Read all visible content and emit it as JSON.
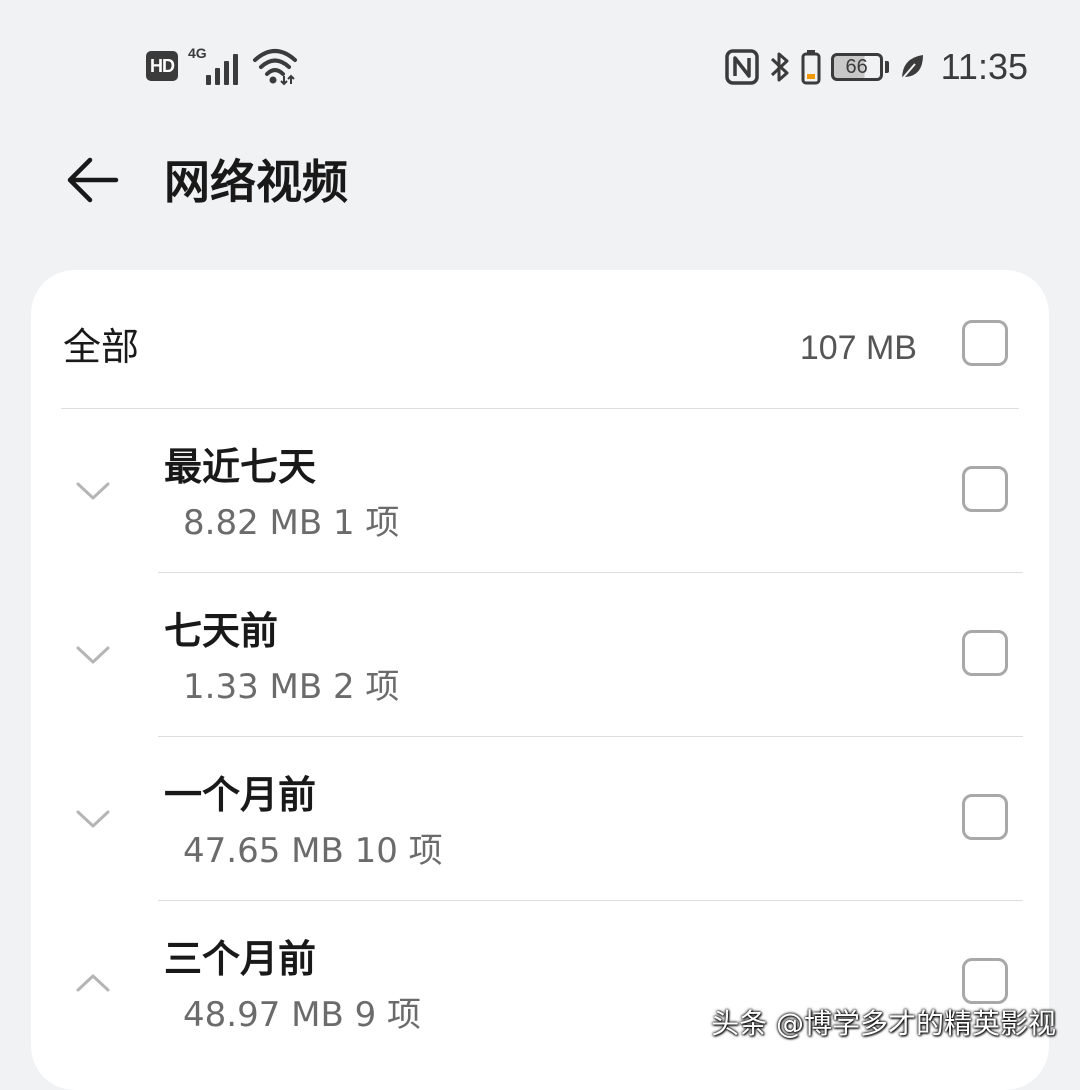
{
  "status_bar": {
    "hd_badge": "HD",
    "network_type": "4G",
    "battery_level": "66",
    "time": "11:35",
    "icons": [
      "hd-icon",
      "signal-icon",
      "wifi-icon",
      "nfc-icon",
      "bluetooth-icon",
      "battery-icon",
      "eco-leaf-icon"
    ]
  },
  "header": {
    "back_icon": "arrow-left-icon",
    "title": "网络视频"
  },
  "summary": {
    "label": "全部",
    "size": "107 MB",
    "checked": false
  },
  "groups": [
    {
      "title": "最近七天",
      "meta": "8.82 MB 1 项",
      "expanded": false,
      "checked": false
    },
    {
      "title": "七天前",
      "meta": "1.33 MB 2 项",
      "expanded": false,
      "checked": false
    },
    {
      "title": "一个月前",
      "meta": "47.65 MB 10 项",
      "expanded": false,
      "checked": false
    },
    {
      "title": "三个月前",
      "meta": "48.97 MB 9 项",
      "expanded": true,
      "checked": false
    }
  ],
  "watermark": "头条 @博学多才的精英影视",
  "colors": {
    "background": "#f1f2f4",
    "card": "#ffffff",
    "text_primary": "#191919",
    "text_secondary": "#6b6b6b",
    "checkbox_border": "#a8a8a8",
    "chevron": "#b5b5b5",
    "battery_low_accent": "#f39800"
  }
}
